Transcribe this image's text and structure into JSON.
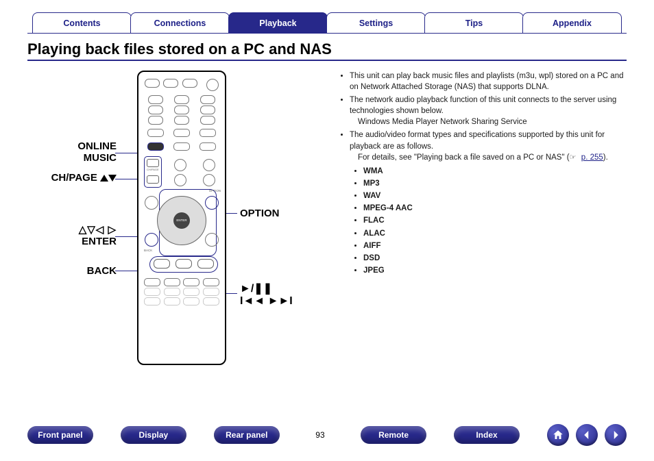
{
  "tabs": {
    "items": [
      "Contents",
      "Connections",
      "Playback",
      "Settings",
      "Tips",
      "Appendix"
    ],
    "active_index": 2
  },
  "heading": "Playing back files stored on a PC and NAS",
  "callouts": {
    "online_music_l1": "ONLINE",
    "online_music_l2": "MUSIC",
    "ch_page": "CH/PAGE",
    "option": "OPTION",
    "enter": "ENTER",
    "back": "BACK",
    "arrows": "△▽◁ ▷",
    "play_pause": "►/❚❚",
    "prev_next": "I◄◄ ►►I"
  },
  "body": {
    "b1": "This unit can play back music files and playlists (m3u, wpl) stored on a PC and on Network Attached Storage (NAS) that supports DLNA.",
    "b2": "The network audio playback function of this unit connects to the server using technologies shown below.",
    "b2a": "Windows Media Player Network Sharing Service",
    "b3": "The audio/video format types and specifications supported by this unit for playback are as follows.",
    "b3a_prefix": "For details, see \"Playing back a file saved on a PC or NAS\" (",
    "b3a_link": "p. 255",
    "b3a_suffix": ").",
    "hand": "☞"
  },
  "formats": [
    "WMA",
    "MP3",
    "WAV",
    "MPEG-4 AAC",
    "FLAC",
    "ALAC",
    "AIFF",
    "DSD",
    "JPEG"
  ],
  "footer": {
    "links": [
      "Front panel",
      "Display",
      "Rear panel",
      "Remote",
      "Index"
    ],
    "page": "93"
  }
}
